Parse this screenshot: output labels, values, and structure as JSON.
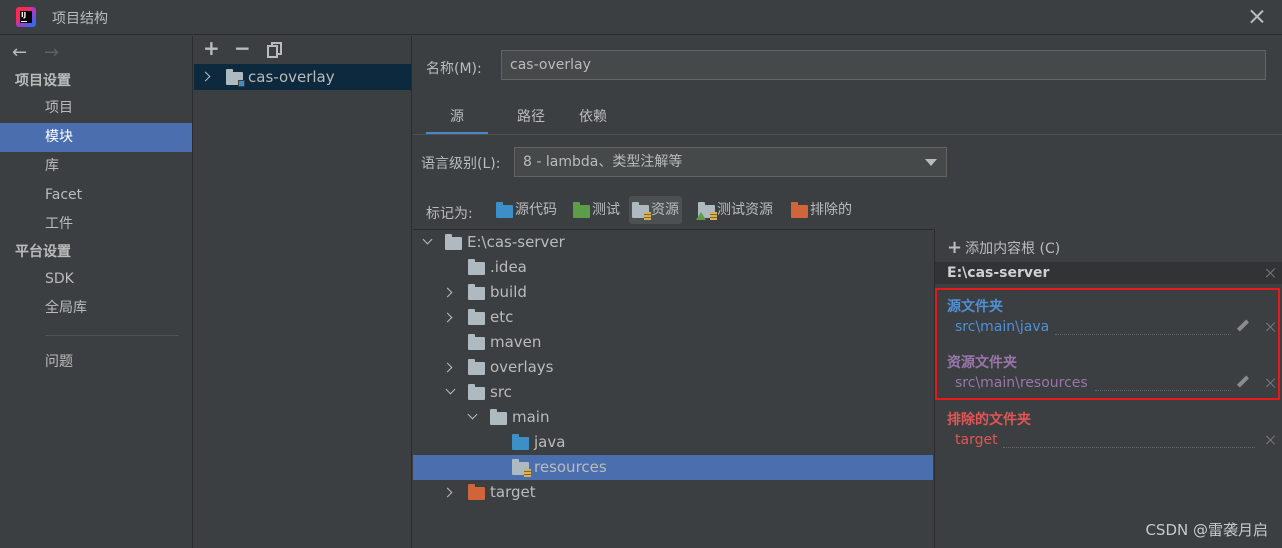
{
  "window": {
    "title": "项目结构"
  },
  "leftnav": {
    "back_arrow": "←",
    "forward_arrow": "→",
    "project_settings_header": "项目设置",
    "project_settings_items": [
      "项目",
      "模块",
      "库",
      "Facet",
      "工件"
    ],
    "selected_item": "模块",
    "platform_settings_header": "平台设置",
    "platform_settings_items": [
      "SDK",
      "全局库"
    ],
    "problems_item": "问题"
  },
  "module_panel": {
    "add_glyph": "+",
    "remove_glyph": "−",
    "modules": [
      {
        "name": "cas-overlay"
      }
    ]
  },
  "main": {
    "name_label": "名称(M):",
    "name_value": "cas-overlay",
    "tabs": [
      "源",
      "路径",
      "依赖"
    ],
    "active_tab": "源",
    "language_level_label": "语言级别(L):",
    "language_level_value": "8 - lambda、类型注解等",
    "mark_as_label": "标记为:",
    "mark_buttons": [
      {
        "label": "源代码",
        "color": "#3d8fc7"
      },
      {
        "label": "测试",
        "color": "#5d9c48"
      },
      {
        "label": "资源",
        "color": "#aeb9c0"
      },
      {
        "label": "测试资源",
        "color": "#aeb9c0"
      },
      {
        "label": "排除的",
        "color": "#d0643b"
      }
    ],
    "active_mark_button": "资源"
  },
  "tree": {
    "root": "E:\\cas-server",
    "nodes": [
      {
        "label": "E:\\cas-server",
        "depth": 0,
        "expanded": true,
        "folder": "plain"
      },
      {
        "label": ".idea",
        "depth": 1,
        "expanded": null,
        "folder": "plain"
      },
      {
        "label": "build",
        "depth": 1,
        "expanded": false,
        "folder": "plain"
      },
      {
        "label": "etc",
        "depth": 1,
        "expanded": false,
        "folder": "plain"
      },
      {
        "label": "maven",
        "depth": 1,
        "expanded": null,
        "folder": "plain"
      },
      {
        "label": "overlays",
        "depth": 1,
        "expanded": false,
        "folder": "plain"
      },
      {
        "label": "src",
        "depth": 1,
        "expanded": true,
        "folder": "plain"
      },
      {
        "label": "main",
        "depth": 2,
        "expanded": true,
        "folder": "plain"
      },
      {
        "label": "java",
        "depth": 3,
        "expanded": null,
        "folder": "source"
      },
      {
        "label": "resources",
        "depth": 3,
        "expanded": null,
        "folder": "resource",
        "selected": true
      },
      {
        "label": "target",
        "depth": 1,
        "expanded": false,
        "folder": "excluded"
      }
    ]
  },
  "roots_panel": {
    "add_content_root": "添加内容根 (C)",
    "root_path": "E:\\cas-server",
    "source_folders_title": "源文件夹",
    "source_folders": [
      "src\\main\\java"
    ],
    "resource_folders_title": "资源文件夹",
    "resource_folders": [
      "src\\main\\resources"
    ],
    "excluded_folders_title": "排除的文件夹",
    "excluded_folders": [
      "target"
    ],
    "colors": {
      "source": "#4f8fd6",
      "resource": "#9876aa",
      "excluded": "#e05555",
      "highlight": "#e8191b"
    }
  },
  "watermark": "CSDN @雷袭月启"
}
